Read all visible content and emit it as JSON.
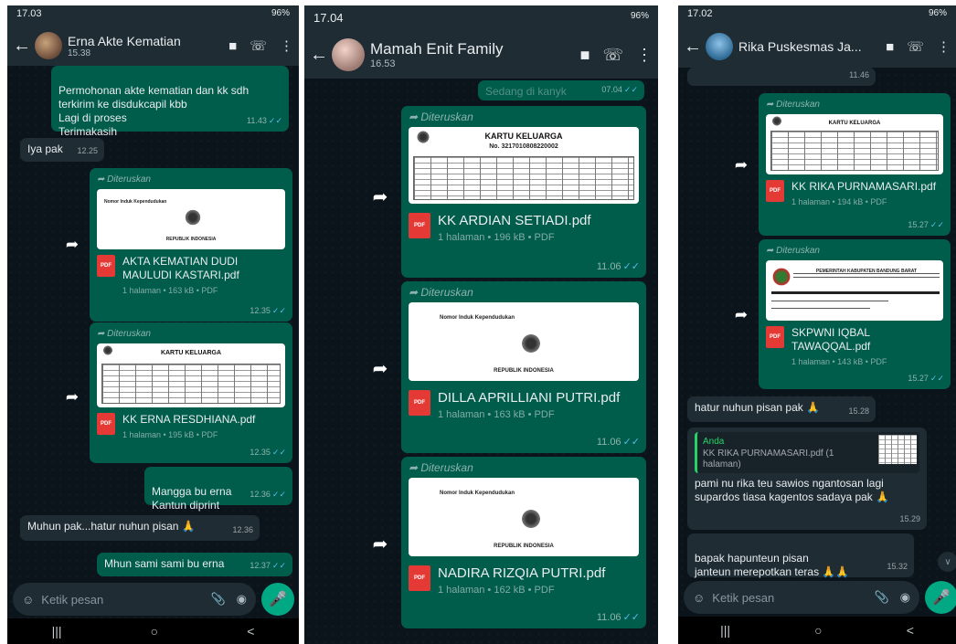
{
  "colors": {
    "incoming": "#1f2c34",
    "outgoing": "#005c4b",
    "accent": "#00a884",
    "tick": "#53bdeb"
  },
  "screens": [
    {
      "status": {
        "time": "17.03",
        "battery": "96%"
      },
      "chat": {
        "name": "Erna Akte Kematian",
        "time": "15.38"
      },
      "m1": {
        "text": "Permohonan akte kematian dan kk sdh terkirim ke disdukcapil kbb\nLagi di proses\nTerimakasih",
        "time": "11.43"
      },
      "m2": {
        "text": "Iya pak",
        "time": "12.25"
      },
      "f1": {
        "fwd": "Diteruskan",
        "name": "AKTA KEMATIAN DUDI MAULUDI KASTARI.pdf",
        "meta": "1 halaman • 163 kB • PDF",
        "time": "12.35",
        "doc_nik": "Nomor Induk Kependudukan",
        "doc_country": "REPUBLIK INDONESIA"
      },
      "f2": {
        "fwd": "Diteruskan",
        "name": "KK ERNA RESDHIANA.pdf",
        "meta": "1 halaman • 195 kB • PDF",
        "time": "12.35",
        "doc_title": "KARTU KELUARGA"
      },
      "m3": {
        "text": "Mangga bu erna\nKantun diprint",
        "time": "12.36"
      },
      "m4": {
        "text": "Muhun pak...hatur nuhun pisan 🙏",
        "time": "12.36"
      },
      "m5": {
        "text": "Mhun sami sami bu erna",
        "time": "12.37"
      },
      "input_placeholder": "Ketik pesan"
    },
    {
      "status": {
        "time": "17.04",
        "battery": "96%"
      },
      "chat": {
        "name": "Mamah Enit Family",
        "time": "16.53"
      },
      "m0": {
        "text": "Sedang di kanyk",
        "time": "07.04"
      },
      "f1": {
        "fwd": "Diteruskan",
        "name": "KK ARDIAN SETIADI.pdf",
        "meta": "1 halaman • 196 kB • PDF",
        "time": "11.06",
        "doc_title": "KARTU KELUARGA",
        "doc_no": "No. 3217010808220002"
      },
      "f2": {
        "fwd": "Diteruskan",
        "name": "DILLA APRILLIANI PUTRI.pdf",
        "meta": "1 halaman • 163 kB • PDF",
        "time": "11.06",
        "doc_nik": "Nomor Induk Kependudukan",
        "doc_country": "REPUBLIK INDONESIA"
      },
      "f3": {
        "fwd": "Diteruskan",
        "name": "NADIRA RIZQIA PUTRI.pdf",
        "meta": "1 halaman • 162 kB • PDF",
        "time": "11.06",
        "doc_nik": "Nomor Induk Kependudukan",
        "doc_country": "REPUBLIK INDONESIA"
      }
    },
    {
      "status": {
        "time": "17.02",
        "battery": "96%"
      },
      "chat": {
        "name": "Rika Puskesmas Ja..."
      },
      "m0": {
        "time": "11.46"
      },
      "f1": {
        "fwd": "Diteruskan",
        "name": "KK RIKA PURNAMASARI.pdf",
        "meta": "1 halaman • 194 kB • PDF",
        "time": "15.27",
        "doc_title": "KARTU KELUARGA"
      },
      "f2": {
        "fwd": "Diteruskan",
        "name": "SKPWNI IQBAL TAWAQQAL.pdf",
        "meta": "1 halaman • 143 kB • PDF",
        "time": "15.27",
        "doc_header": "PEMERINTAH KABUPATEN BANDUNG BARAT"
      },
      "m1": {
        "text": "hatur nuhun pisan pak 🙏",
        "time": "15.28"
      },
      "m2": {
        "quote_author": "Anda",
        "quote_text": "KK RIKA PURNAMASARI.pdf (1 halaman)",
        "text": "pami nu rika teu sawios ngantosan lagi supardos tiasa kagentos sadaya pak 🙏",
        "time": "15.29"
      },
      "m3": {
        "text": "bapak hapunteun pisan\njanteun merepotkan teras 🙏🙏",
        "time": "15.32"
      },
      "input_placeholder": "Ketik pesan"
    }
  ]
}
